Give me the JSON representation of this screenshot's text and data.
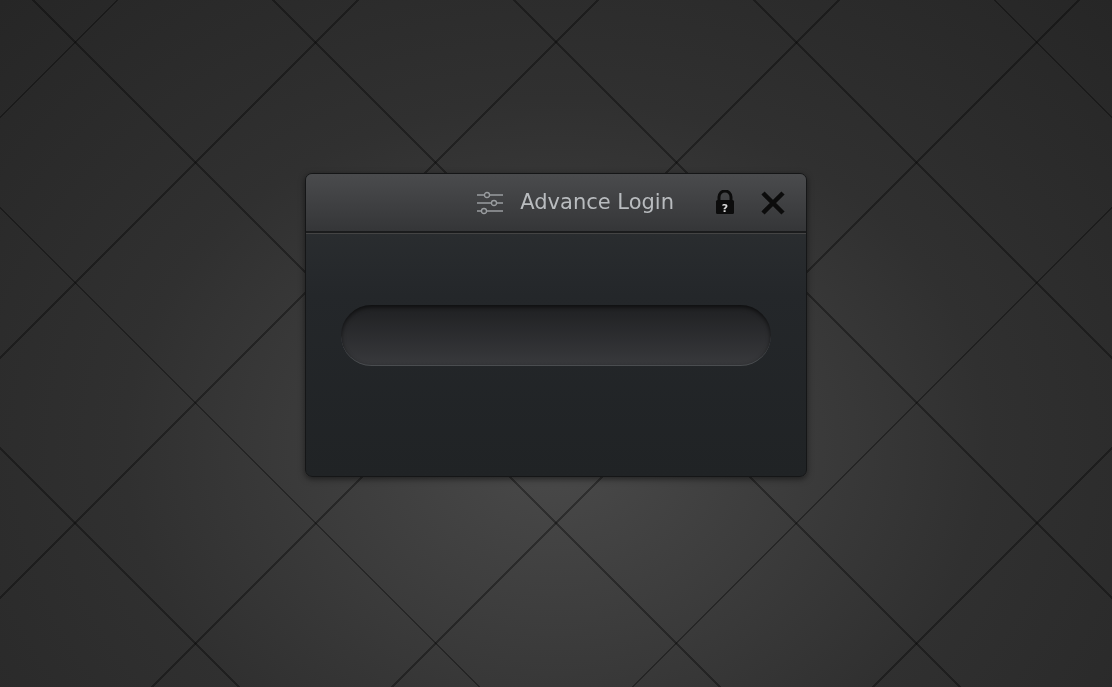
{
  "dialog": {
    "title": "Advance Login",
    "lock_mark": "?"
  }
}
